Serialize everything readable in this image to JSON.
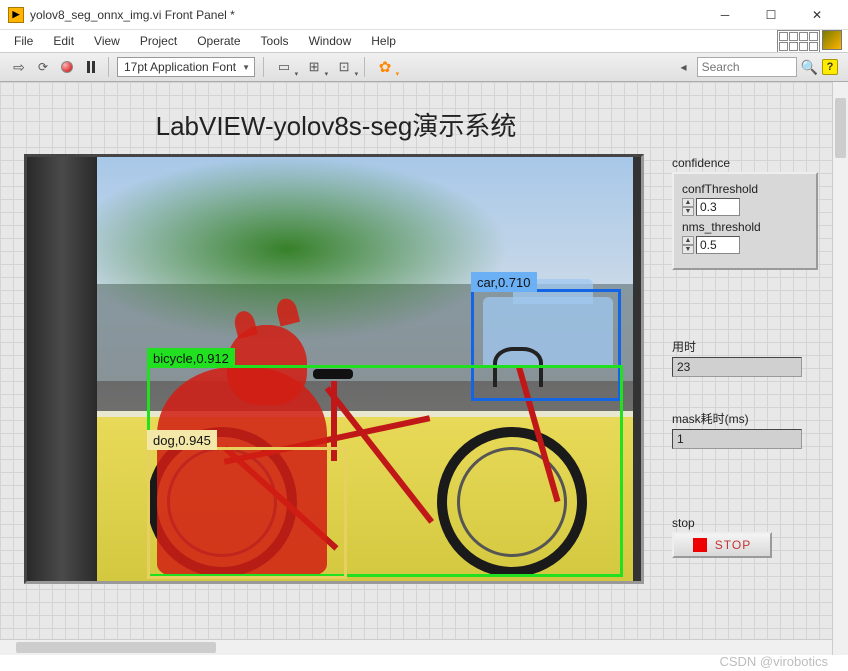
{
  "window": {
    "title": "yolov8_seg_onnx_img.vi Front Panel *"
  },
  "menu": {
    "items": [
      "File",
      "Edit",
      "View",
      "Project",
      "Operate",
      "Tools",
      "Window",
      "Help"
    ]
  },
  "toolbar": {
    "font": "17pt Application Font",
    "search_placeholder": "Search"
  },
  "main": {
    "title": "LabVIEW-yolov8s-seg演示系统"
  },
  "detections": {
    "car": {
      "label": "car,0.710"
    },
    "bicycle": {
      "label": "bicycle,0.912"
    },
    "dog": {
      "label": "dog,0.945"
    }
  },
  "controls": {
    "confidence": {
      "group_label": "confidence",
      "confThreshold": {
        "label": "confThreshold",
        "value": "0.3"
      },
      "nms_threshold": {
        "label": "nms_threshold",
        "value": "0.5"
      }
    },
    "elapsed": {
      "label": "用时",
      "value": "23"
    },
    "masktime": {
      "label": "mask耗时(ms)",
      "value": "1"
    },
    "stop": {
      "label": "stop",
      "button": "STOP"
    }
  },
  "watermark": "CSDN @virobotics"
}
